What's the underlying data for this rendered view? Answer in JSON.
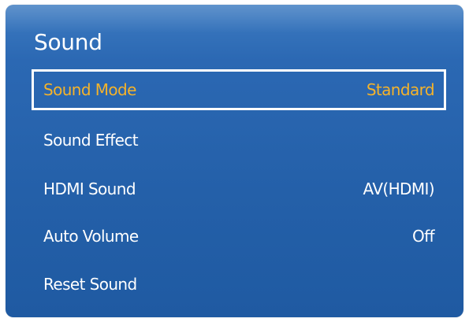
{
  "menu": {
    "title": "Sound",
    "items": [
      {
        "label": "Sound Mode",
        "value": "Standard",
        "selected": true
      },
      {
        "label": "Sound Effect",
        "value": ""
      },
      {
        "label": "HDMI Sound",
        "value": "AV(HDMI)"
      },
      {
        "label": "Auto Volume",
        "value": "Off"
      },
      {
        "label": "Reset Sound",
        "value": ""
      }
    ]
  },
  "colors": {
    "panel_background": "#2460a9",
    "selected_text": "#f5b32a",
    "text": "#ffffff",
    "selection_border": "#ffffff"
  }
}
